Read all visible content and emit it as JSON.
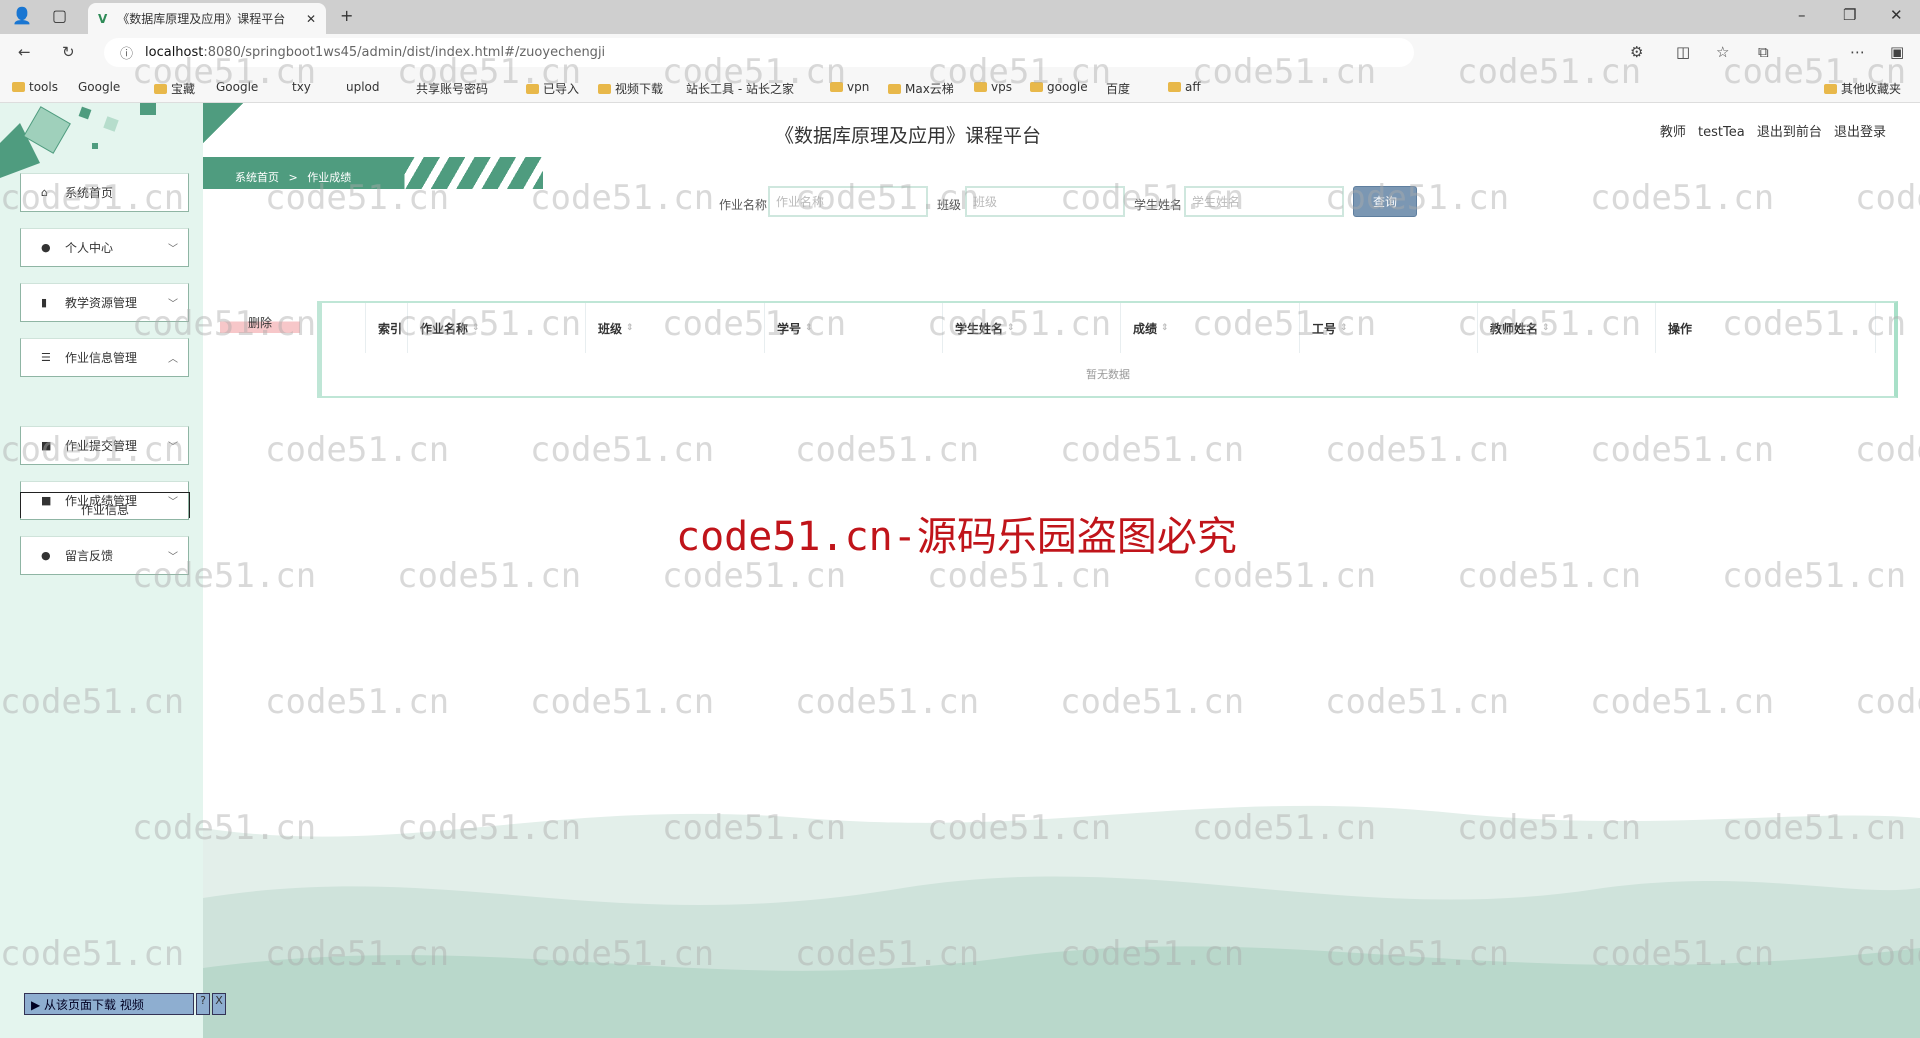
{
  "browser": {
    "tab_title": "《数据库原理及应用》课程平台",
    "url_host": "localhost",
    "url_rest": ":8080/springboot1ws45/admin/dist/index.html#/zuoyechengji",
    "bookmarks": [
      {
        "label": "tools",
        "type": "folder"
      },
      {
        "label": "Google",
        "type": "page"
      },
      {
        "label": "宝藏",
        "type": "folder"
      },
      {
        "label": "Google",
        "type": "google"
      },
      {
        "label": "txy",
        "type": "cloud"
      },
      {
        "label": "uplod",
        "type": "cloud"
      },
      {
        "label": "共享账号密码",
        "type": "app"
      },
      {
        "label": "已导入",
        "type": "folder"
      },
      {
        "label": "视频下载",
        "type": "folder"
      },
      {
        "label": "站长工具 - 站长之家",
        "type": "app"
      },
      {
        "label": "vpn",
        "type": "folder"
      },
      {
        "label": "Max云梯",
        "type": "folder"
      },
      {
        "label": "vps",
        "type": "folder"
      },
      {
        "label": "google",
        "type": "folder"
      },
      {
        "label": "百度",
        "type": "baidu"
      },
      {
        "label": "aff",
        "type": "folder"
      }
    ],
    "other_bookmarks": "其他收藏夹"
  },
  "header": {
    "title": "《数据库原理及应用》课程平台",
    "user": "教师 testTea",
    "to_front": "退出到前台",
    "logout": "退出登录"
  },
  "breadcrumb": {
    "home": "系统首页",
    "sep": ">",
    "current": "作业成绩"
  },
  "sidebar": {
    "items": [
      {
        "label": "系统首页",
        "icon": "home-icon",
        "glyph": "⌂",
        "chev": ""
      },
      {
        "label": "个人中心",
        "icon": "user-icon",
        "glyph": "●",
        "chev": "﹀"
      },
      {
        "label": "教学资源管理",
        "icon": "book-icon",
        "glyph": "▮",
        "chev": "﹀"
      },
      {
        "label": "作业信息管理",
        "icon": "list-icon",
        "glyph": "☰",
        "chev": "︿"
      },
      {
        "label": "作业提交管理",
        "icon": "wallet-icon",
        "glyph": "■",
        "chev": "﹀"
      },
      {
        "label": "作业成绩管理",
        "icon": "briefcase-icon",
        "glyph": "■",
        "chev": "﹀"
      },
      {
        "label": "留言反馈",
        "icon": "user-icon",
        "glyph": "●",
        "chev": "﹀"
      }
    ],
    "submenu": "作业信息"
  },
  "search": {
    "fields": [
      {
        "label": "作业名称",
        "placeholder": "作业名称",
        "value": ""
      },
      {
        "label": "班级",
        "placeholder": "班级",
        "value": ""
      },
      {
        "label": "学生姓名",
        "placeholder": "学生姓名",
        "value": ""
      }
    ],
    "button": "查询"
  },
  "actions": {
    "delete": "删除"
  },
  "table": {
    "columns": [
      "",
      "索引",
      "作业名称",
      "班级",
      "学号",
      "学生姓名",
      "成绩",
      "工号",
      "教师姓名",
      "操作"
    ],
    "sortable": [
      false,
      false,
      true,
      true,
      true,
      true,
      true,
      true,
      true,
      false
    ],
    "empty": "暂无数据",
    "rows": []
  },
  "watermark": {
    "small": "code51.cn",
    "big": "code51.cn-源码乐园盗图必究"
  },
  "download_bar": {
    "label": "▶ 从该页面下载 视频",
    "help": "?",
    "close": "X"
  },
  "colors": {
    "accent": "#4f9c7f",
    "sidebar_bg": "#e4f5ee",
    "button": "#7b97b3",
    "watermark_red": "#c0141a"
  }
}
